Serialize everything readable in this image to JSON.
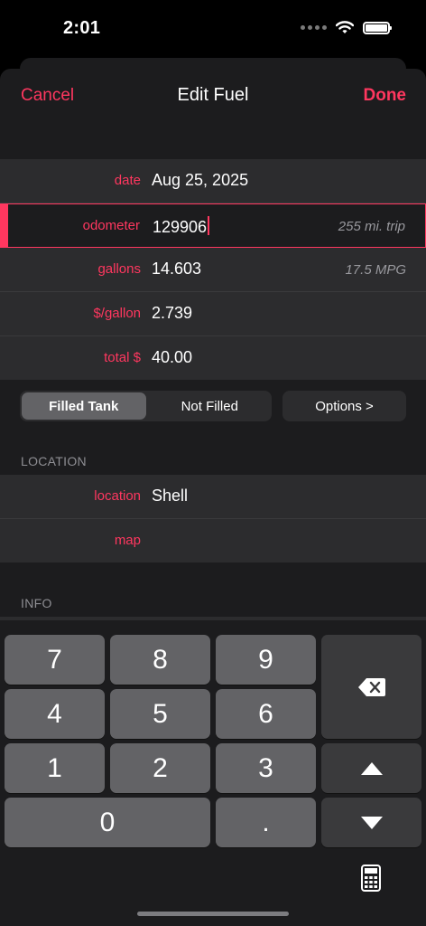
{
  "status": {
    "time": "2:01"
  },
  "nav": {
    "cancel": "Cancel",
    "title": "Edit Fuel",
    "done": "Done"
  },
  "fields": {
    "date": {
      "label": "date",
      "value": "Aug 25, 2025"
    },
    "odometer": {
      "label": "odometer",
      "value": "129906",
      "aux": "255 mi. trip"
    },
    "gallons": {
      "label": "gallons",
      "value": "14.603",
      "aux": "17.5 MPG"
    },
    "price": {
      "label": "$/gallon",
      "value": "2.739"
    },
    "total": {
      "label": "total $",
      "value": "40.00"
    }
  },
  "fill_toggle": {
    "options": [
      "Filled Tank",
      "Not Filled"
    ],
    "selected": "Filled Tank"
  },
  "options_button": "Options >",
  "location_section": {
    "header": "LOCATION",
    "location": {
      "label": "location",
      "value": "Shell"
    },
    "map": {
      "label": "map"
    }
  },
  "info_section": {
    "header": "INFO"
  },
  "keypad": {
    "keys": [
      "7",
      "8",
      "9",
      "4",
      "5",
      "6",
      "1",
      "2",
      "3",
      "0",
      "."
    ],
    "icons": [
      "delete-icon",
      "arrow-up-icon",
      "arrow-down-icon",
      "calculator-icon"
    ]
  },
  "colors": {
    "accent": "#ff375f",
    "background": "#1c1c1e",
    "cell": "#2c2c2e",
    "key": "#636366"
  }
}
